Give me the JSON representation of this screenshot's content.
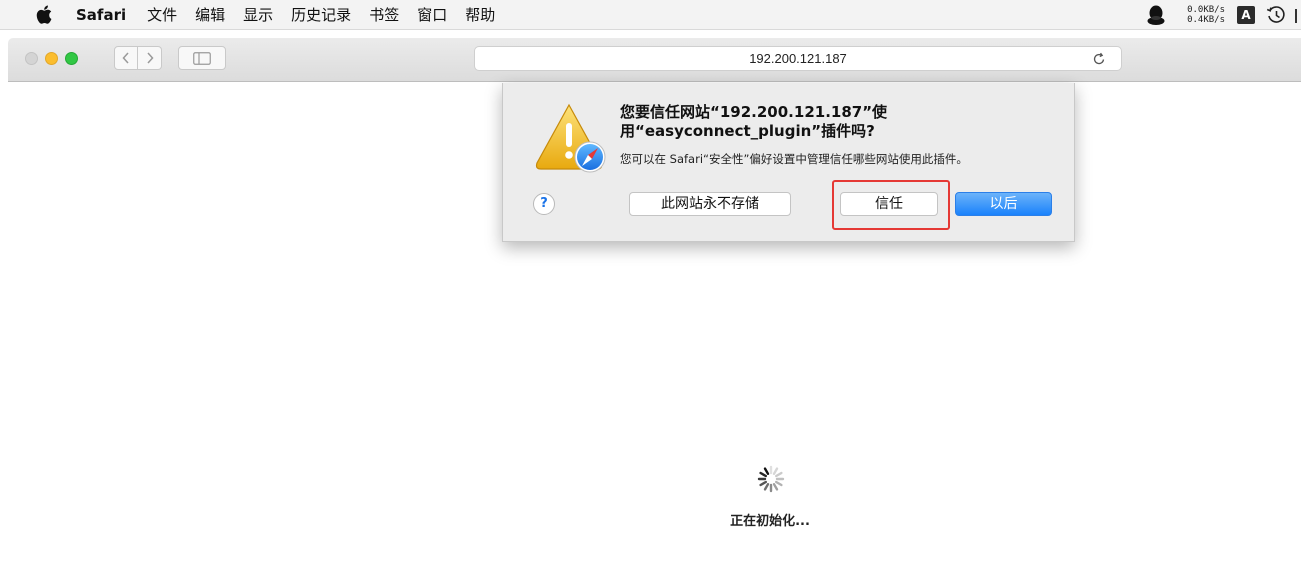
{
  "menubar": {
    "app_name": "Safari",
    "items": [
      "文件",
      "编辑",
      "显示",
      "历史记录",
      "书签",
      "窗口",
      "帮助"
    ],
    "net_down": "0.0KB/s",
    "net_up": "0.4KB/s",
    "input_source": "A"
  },
  "toolbar": {
    "address": "192.200.121.187"
  },
  "dialog": {
    "title": "您要信任网站“192.200.121.187”使用“easyconnect_plugin”插件吗?",
    "message": "您可以在 Safari“安全性”偏好设置中管理信任哪些网站使用此插件。",
    "help_label": "?",
    "never_label": "此网站永不存储",
    "trust_label": "信任",
    "later_label": "以后"
  },
  "page": {
    "loading_text": "正在初始化..."
  },
  "colors": {
    "accent_blue": "#1a82fb",
    "highlight_red": "#e53935",
    "traffic_yellow": "#fbbd2e",
    "traffic_green": "#31c744"
  },
  "icons": [
    "apple-icon",
    "qq-icon",
    "time-machine-icon",
    "back-icon",
    "forward-icon",
    "sidebar-icon",
    "reload-icon",
    "warning-icon",
    "safari-compass-icon",
    "spinner-icon"
  ]
}
